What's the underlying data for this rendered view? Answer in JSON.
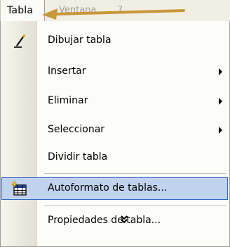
{
  "menubar": {
    "tabla_label": "Tabla",
    "ventana_label": "Ventana",
    "help_label": "?"
  },
  "menu": {
    "items": [
      {
        "label": "Dibujar tabla",
        "icon": "pencil-icon",
        "submenu": false
      },
      {
        "label": "Insertar",
        "icon": null,
        "submenu": true
      },
      {
        "label": "Eliminar",
        "icon": null,
        "submenu": true
      },
      {
        "label": "Seleccionar",
        "icon": null,
        "submenu": true
      },
      {
        "label": "Dividir tabla",
        "icon": null,
        "submenu": false
      },
      {
        "label": "Autoformato de tablas...",
        "icon": "table-autoformat-icon",
        "submenu": false,
        "highlighted": true
      },
      {
        "label": "Propiedades de tabla...",
        "icon": null,
        "submenu": false
      }
    ],
    "expand_icon": "double-chevron-down-icon"
  },
  "annotation": {
    "arrow_color": "#c8963c"
  },
  "colors": {
    "highlight_fill": "#c1d2ee",
    "highlight_border": "#316ac5",
    "menubar_bg": "#f1efe2"
  }
}
